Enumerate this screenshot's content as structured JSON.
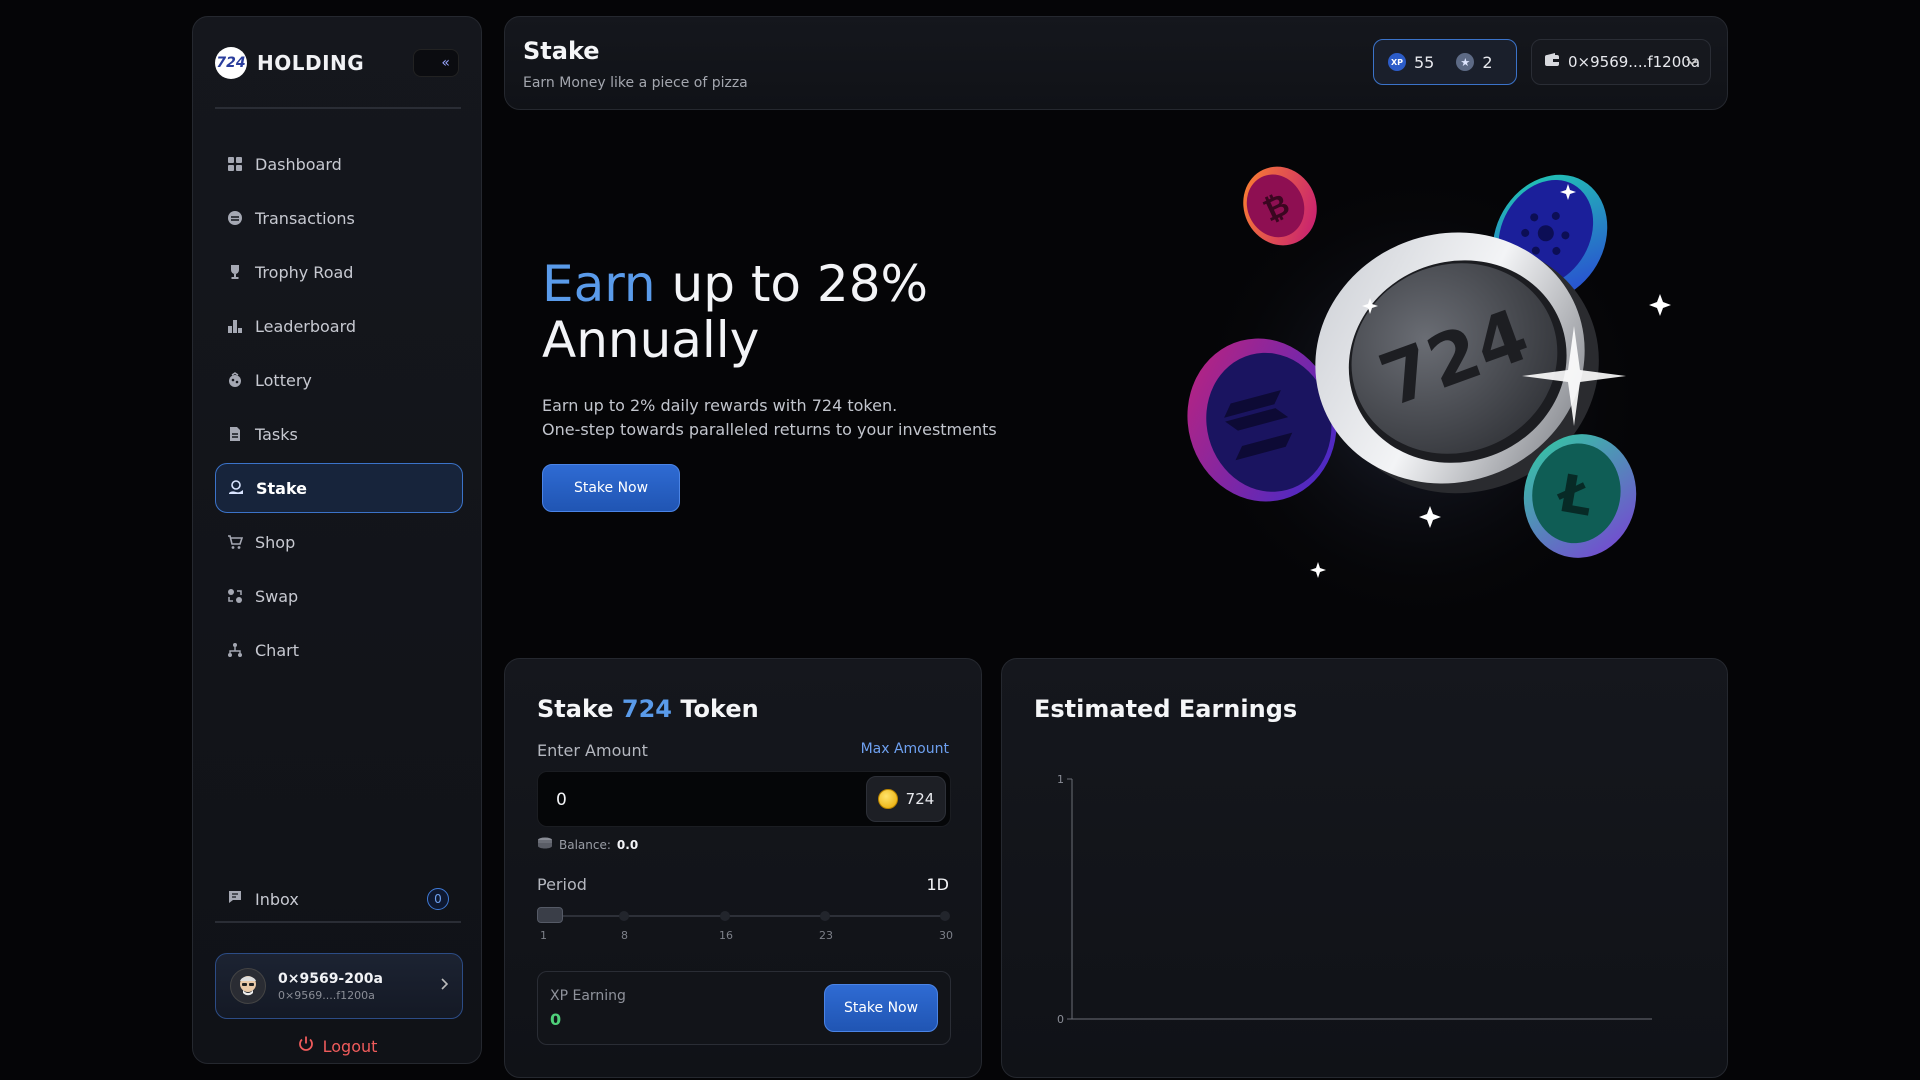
{
  "sidebar": {
    "brand_logo_text": "724",
    "brand_name": "HOLDING",
    "collapse_label": "«",
    "items": [
      {
        "label": "Dashboard",
        "icon": "grid-icon"
      },
      {
        "label": "Transactions",
        "icon": "transactions-icon"
      },
      {
        "label": "Trophy Road",
        "icon": "trophy-icon"
      },
      {
        "label": "Leaderboard",
        "icon": "leaderboard-icon"
      },
      {
        "label": "Lottery",
        "icon": "lottery-icon"
      },
      {
        "label": "Tasks",
        "icon": "tasks-icon"
      },
      {
        "label": "Stake",
        "icon": "stake-icon",
        "active": true
      },
      {
        "label": "Shop",
        "icon": "cart-icon"
      },
      {
        "label": "Swap",
        "icon": "swap-icon"
      },
      {
        "label": "Chart",
        "icon": "chart-icon"
      }
    ],
    "inbox": {
      "label": "Inbox",
      "count": "0"
    },
    "user": {
      "name": "0×9569-200a",
      "address": "0×9569....f1200a"
    },
    "logout_label": "Logout"
  },
  "header": {
    "title": "Stake",
    "subtitle": "Earn Money like a piece of pizza",
    "xp": "55",
    "stars": "2",
    "wallet": "0×9569....f1200a"
  },
  "hero": {
    "title_highlight": "Earn",
    "title_rest": " up to 28%",
    "title_line2": "Annually",
    "sub_line1": "Earn up to 2% daily rewards with 724 token.",
    "sub_line2": "One-step towards paralleled returns to your investments",
    "button": "Stake Now",
    "coin_label": "724"
  },
  "stake_form": {
    "title_pre": "Stake ",
    "title_token": "724",
    "title_post": " Token",
    "amount_label": "Enter Amount",
    "max_label": "Max Amount",
    "amount_value": "0",
    "token": "724",
    "balance_label": "Balance:",
    "balance_value": "0.0",
    "period_label": "Period",
    "period_value": "1D",
    "period_ticks": [
      "1",
      "8",
      "16",
      "23",
      "30"
    ],
    "xp_label": "XP Earning",
    "xp_value": "0",
    "button": "Stake Now"
  },
  "earnings": {
    "title": "Estimated Earnings"
  },
  "chart_data": {
    "type": "line",
    "title": "Estimated Earnings",
    "x": [],
    "series": [],
    "ylim": [
      0,
      1
    ],
    "yticks": [
      "0",
      "1"
    ],
    "grid": false
  }
}
